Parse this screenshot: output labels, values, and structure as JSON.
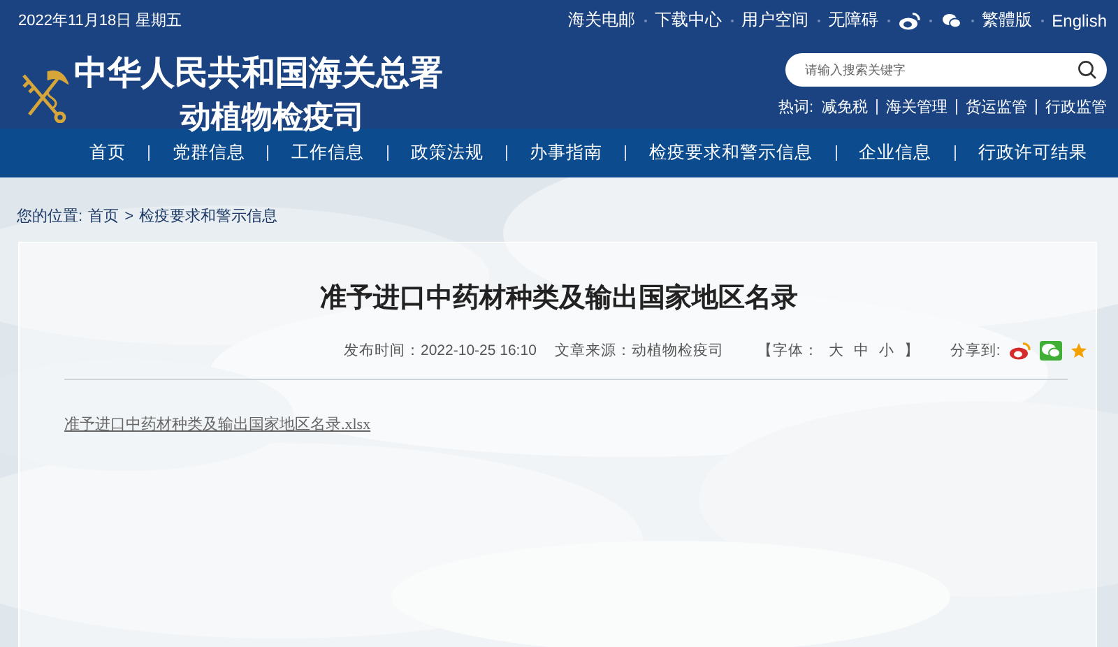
{
  "header": {
    "date": "2022年11月18日 星期五",
    "top_links_left": [
      "海关电邮",
      "下载中心",
      "用户空间",
      "无障碍"
    ],
    "top_links_right": [
      "繁體版",
      "English"
    ],
    "site_title": "中华人民共和国海关总署",
    "site_subtitle": "动植物检疫司",
    "search": {
      "placeholder": "请输入搜索关键字"
    },
    "hot_label": "热词:",
    "hot_words": [
      "减免税",
      "海关管理",
      "货运监管",
      "行政监管"
    ]
  },
  "nav": [
    "首页",
    "党群信息",
    "工作信息",
    "政策法规",
    "办事指南",
    "检疫要求和警示信息",
    "企业信息",
    "行政许可结果"
  ],
  "breadcrumb": {
    "label": "您的位置:",
    "items": [
      "首页",
      "检疫要求和警示信息"
    ],
    "separator": ">"
  },
  "article": {
    "title": "准予进口中药材种类及输出国家地区名录",
    "published": "发布时间：2022-10-25 16:10",
    "source": "文章来源：动植物检疫司",
    "font_open": "【字体：",
    "font_sizes": [
      "大",
      "中",
      "小"
    ],
    "font_close": "】",
    "share_label": "分享到:",
    "attachment": "准予进口中药材种类及输出国家地区名录.xlsx"
  }
}
